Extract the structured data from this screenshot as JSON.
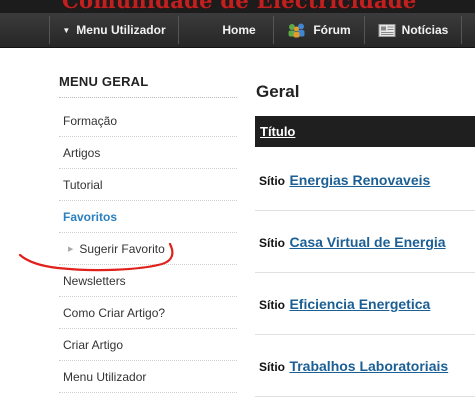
{
  "site": {
    "title": "Comunidade de Electricidade"
  },
  "navbar": {
    "user_menu": "Menu Utilizador",
    "home": "Home",
    "forum": "Fórum",
    "news": "Notícias"
  },
  "sidebar": {
    "title": "MENU GERAL",
    "items": [
      {
        "label": "Formação"
      },
      {
        "label": "Artigos"
      },
      {
        "label": "Tutorial"
      },
      {
        "label": "Favoritos",
        "active": true
      },
      {
        "label": "Sugerir Favorito",
        "sub": true
      },
      {
        "label": "Newsletters"
      },
      {
        "label": "Como Criar Artigo?"
      },
      {
        "label": "Criar Artigo"
      },
      {
        "label": "Menu Utilizador"
      }
    ]
  },
  "main": {
    "title": "Geral",
    "column_header": "Título",
    "rows": [
      {
        "prefix": "Sítio",
        "link": "Energias Renovaveis"
      },
      {
        "prefix": "Sítio",
        "link": "Casa Virtual de Energia"
      },
      {
        "prefix": "Sítio",
        "link": "Eficiencia Energetica"
      },
      {
        "prefix": "Sítio",
        "link": "Trabalhos Laboratoriais"
      }
    ]
  },
  "colors": {
    "navbar": "#2e2e2e",
    "accent_link": "#1b5f95",
    "active_item": "#2a7fc0",
    "annotation": "#e0201b"
  }
}
